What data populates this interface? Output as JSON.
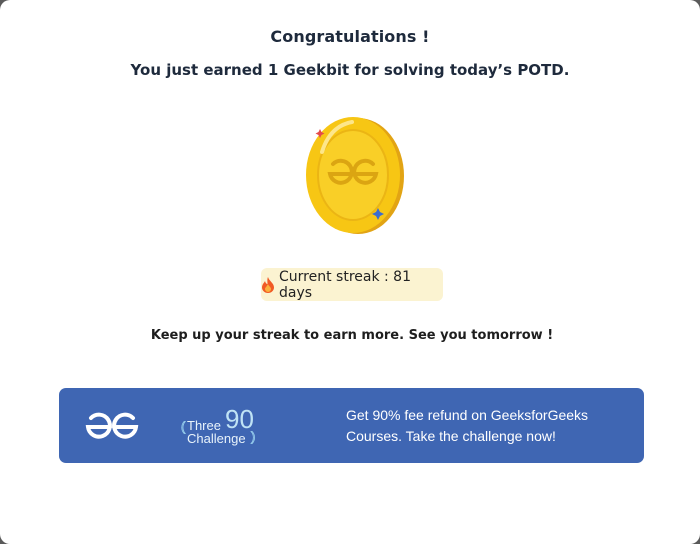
{
  "dialog": {
    "title": "Congratulations !",
    "subtitle": "You just earned 1 Geekbit for solving today’s POTD.",
    "coin_icon": "geekbit-coin-icon",
    "streak": {
      "icon": "fire-icon",
      "label": "Current streak : 81 days"
    },
    "message": "Keep up your streak to earn more. See you tomorrow !"
  },
  "banner": {
    "logo_icon": "gfg-logo-icon",
    "challenge_logo": {
      "word_top": "Three",
      "number": "90",
      "word_bottom": "Challenge"
    },
    "promo_text": "Get 90% fee refund on GeeksforGeeks Courses. Take the challenge now!"
  },
  "colors": {
    "title_text": "#1e2a3c",
    "coin_gold": "#f6c20f",
    "coin_shadow": "#e2a414",
    "streak_bg": "#fbf3d1",
    "banner_bg": "#3f66b3"
  }
}
